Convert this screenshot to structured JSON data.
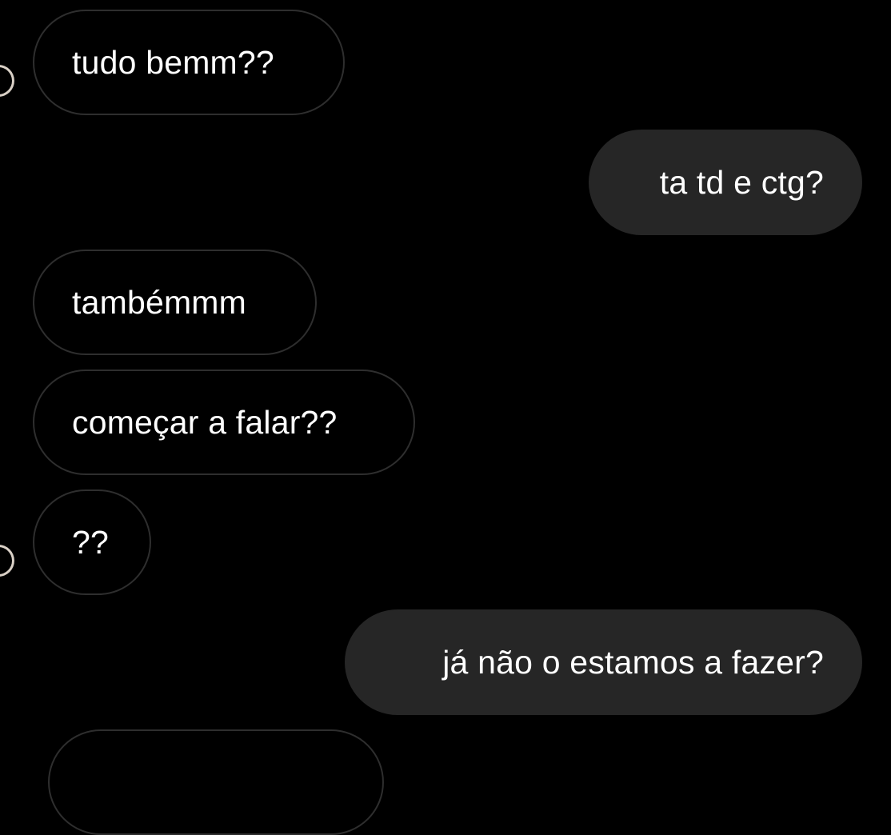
{
  "conversation": {
    "messages": [
      {
        "direction": "incoming",
        "text": "tudo bemm??"
      },
      {
        "direction": "outgoing",
        "text": "ta td e ctg?"
      },
      {
        "direction": "incoming",
        "text": "tambémmm"
      },
      {
        "direction": "incoming",
        "text": "começar a falar??"
      },
      {
        "direction": "incoming",
        "text": "??"
      },
      {
        "direction": "outgoing",
        "text": "já não o estamos a fazer?"
      }
    ]
  },
  "colors": {
    "background": "#000000",
    "incoming_border": "#2e2e2e",
    "outgoing_fill": "#262626",
    "text": "#ffffff"
  }
}
